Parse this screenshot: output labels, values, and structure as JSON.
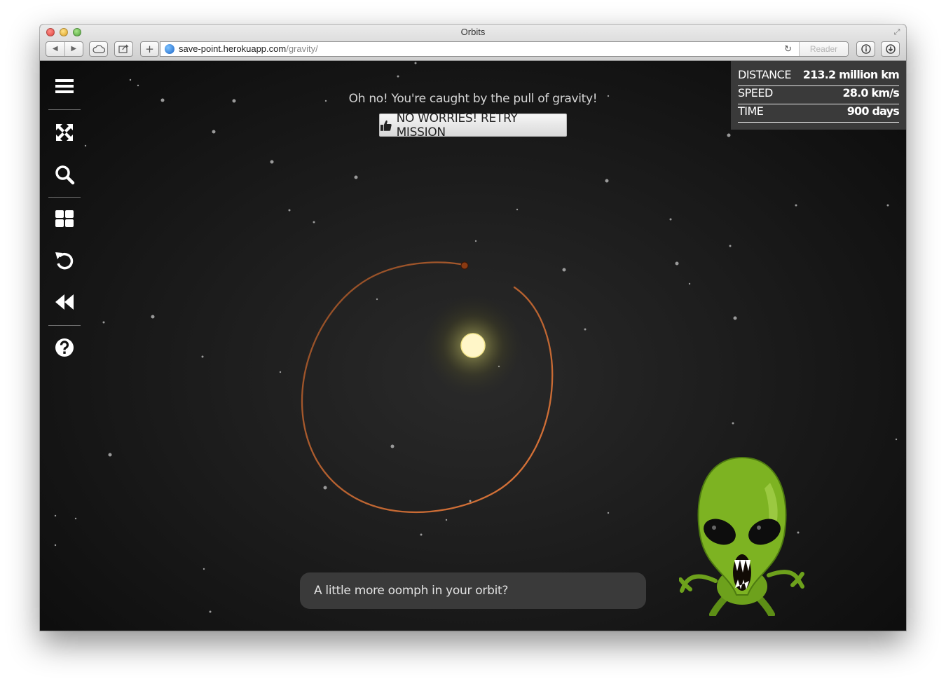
{
  "browser": {
    "window_title": "Orbits",
    "url_host": "save-point.herokuapp.com",
    "url_path": "/gravity/",
    "reader_label": "Reader"
  },
  "toolbar": {
    "items": [
      {
        "name": "menu-icon"
      },
      {
        "name": "fullscreen-arrows-icon"
      },
      {
        "name": "search-icon"
      },
      {
        "name": "grid-icon"
      },
      {
        "name": "undo-icon"
      },
      {
        "name": "rewind-icon"
      },
      {
        "name": "help-icon"
      }
    ]
  },
  "game": {
    "message": "Oh no! You're caught by the pull of gravity!",
    "retry_label": "NO WORRIES! RETRY MISSION",
    "hint": "A little more oomph in your orbit?"
  },
  "stats": {
    "distance_label": "DISTANCE",
    "distance_value": "213.2 million km",
    "speed_label": "SPEED",
    "speed_value": "28.0 km/s",
    "time_label": "TIME",
    "time_value": "900 days"
  },
  "colors": {
    "orbit": "#b5582a",
    "sun": "#fff6c8",
    "alien": "#7db322",
    "planet": "#8a3a12"
  }
}
